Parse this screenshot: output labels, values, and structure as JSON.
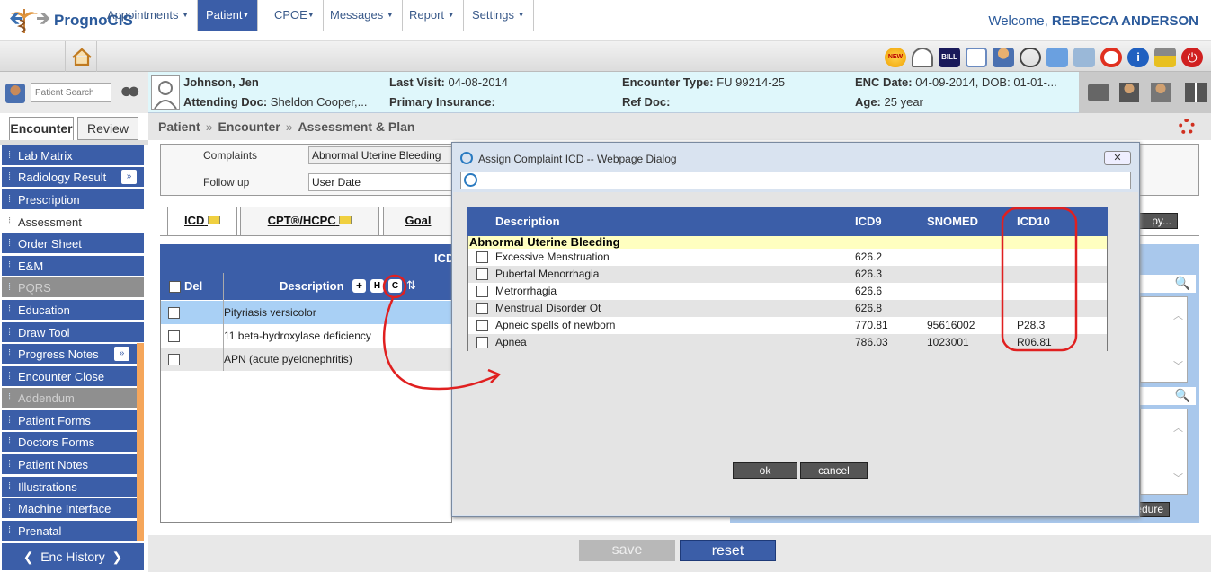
{
  "app": {
    "name": "PrognoCIS",
    "welcome_prefix": "Welcome,",
    "user": "REBECCA ANDERSON"
  },
  "menu": [
    {
      "label": "Appointments"
    },
    {
      "label": "Patient"
    },
    {
      "label": "CPOE"
    },
    {
      "label": "Messages"
    },
    {
      "label": "Report"
    },
    {
      "label": "Settings"
    }
  ],
  "patient": {
    "search_placeholder": "Patient Search",
    "name": "Johnson, Jen",
    "attending_label": "Attending Doc:",
    "attending": "Sheldon Cooper,...",
    "last_visit_label": "Last Visit:",
    "last_visit": "04-08-2014",
    "insurance_label": "Primary Insurance:",
    "insurance": "",
    "enc_type_label": "Encounter Type:",
    "enc_type": "FU 99214-25",
    "ref_doc_label": "Ref Doc:",
    "ref_doc": "",
    "enc_date_label": "ENC Date:",
    "enc_date": "04-09-2014, DOB: 01-01-...",
    "age_label": "Age:",
    "age": "25 year"
  },
  "breadcrumb": {
    "a": "Patient",
    "sep": "»",
    "b": "Encounter",
    "c": "Assessment & Plan"
  },
  "subtabs": {
    "encounter": "Encounter",
    "review": "Review"
  },
  "sidebar": [
    {
      "label": "Lab Matrix"
    },
    {
      "label": "Radiology Result"
    },
    {
      "label": "Prescription"
    },
    {
      "label": "Assessment"
    },
    {
      "label": "Order Sheet"
    },
    {
      "label": "E&M"
    },
    {
      "label": "PQRS"
    },
    {
      "label": "Education"
    },
    {
      "label": "Draw Tool"
    },
    {
      "label": "Progress Notes"
    },
    {
      "label": "Encounter Close"
    },
    {
      "label": "Addendum"
    },
    {
      "label": "Patient Forms"
    },
    {
      "label": "Doctors Forms"
    },
    {
      "label": "Patient Notes"
    },
    {
      "label": "Illustrations"
    },
    {
      "label": "Machine Interface"
    },
    {
      "label": "Prenatal"
    }
  ],
  "enc_history": "Enc History",
  "form": {
    "complaints_label": "Complaints",
    "complaints_value": "Abnormal Uterine Bleeding",
    "followup_label": "Follow up",
    "followup_value": "User Date"
  },
  "tabs": {
    "icd": "ICD",
    "cpt": "CPT®/HCPC",
    "goal": "Goal"
  },
  "icd_grid": {
    "header": "ICD",
    "col_del": "Del",
    "col_desc": "Description",
    "btn_plus": "+",
    "btn_h": "H",
    "btn_c": "C",
    "rows": [
      {
        "desc": "Pityriasis versicolor"
      },
      {
        "desc": "11 beta-hydroxylase deficiency"
      },
      {
        "desc": "APN (acute pyelonephritis)"
      }
    ]
  },
  "right": {
    "copy_btn": "py...",
    "procedure_btn": "edure"
  },
  "dialog": {
    "title": "Assign Complaint ICD -- Webpage Dialog",
    "close": "✕",
    "columns": {
      "desc": "Description",
      "icd9": "ICD9",
      "snomed": "SNOMED",
      "icd10": "ICD10"
    },
    "group": "Abnormal Uterine Bleeding",
    "rows": [
      {
        "desc": "Excessive Menstruation",
        "icd9": "626.2",
        "snomed": "",
        "icd10": ""
      },
      {
        "desc": "Pubertal Menorrhagia",
        "icd9": "626.3",
        "snomed": "",
        "icd10": ""
      },
      {
        "desc": "Metrorrhagia",
        "icd9": "626.6",
        "snomed": "",
        "icd10": ""
      },
      {
        "desc": "Menstrual Disorder Ot",
        "icd9": "626.8",
        "snomed": "",
        "icd10": ""
      },
      {
        "desc": "Apneic spells of newborn",
        "icd9": "770.81",
        "snomed": "95616002",
        "icd10": "P28.3"
      },
      {
        "desc": "Apnea",
        "icd9": "786.03",
        "snomed": "1023001",
        "icd10": "R06.81"
      }
    ],
    "ok": "ok",
    "cancel": "cancel"
  },
  "footer": {
    "save": "save",
    "reset": "reset"
  },
  "colors": {
    "primary": "#3b5ea8",
    "accent": "#f5a65b",
    "highlight": "#ffffc0",
    "annotation": "#e02020"
  }
}
